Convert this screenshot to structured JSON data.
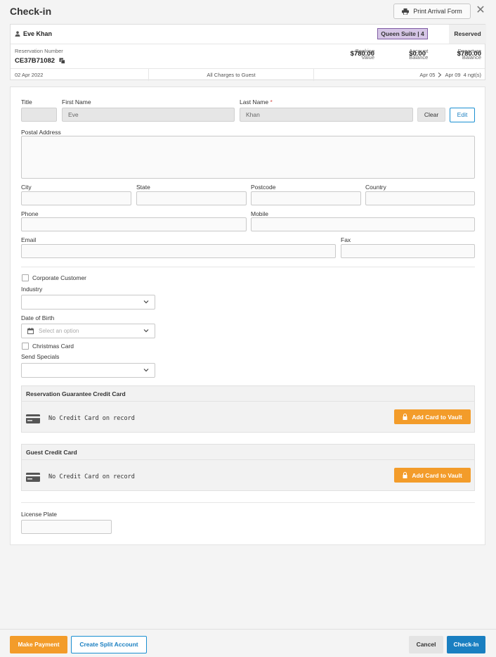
{
  "header": {
    "title": "Check-in",
    "print_label": "Print Arrival Form",
    "close_glyph": "✕"
  },
  "summary": {
    "guest_name": "Eve Khan",
    "room": "Queen Suite | 4",
    "status": "Reserved",
    "reservation_number_label": "Reservation Number",
    "reservation_number": "CE37B71082",
    "booking_value_label": "Booking Value",
    "booking_value": "$780.00",
    "account_balance_label": "Account Balance",
    "account_balance": "$0.00",
    "departure_balance_label": "Departure Balance",
    "departure_balance": "$780.00",
    "booked_date": "02 Apr 2022",
    "charges": "All Charges to Guest",
    "arrival": "Apr 05",
    "departure": "Apr 09",
    "nights": "4 ngt(s)",
    "room_color": "#d6c6e6"
  },
  "form": {
    "title_label": "Title",
    "title_value": "",
    "first_name_label": "First Name",
    "first_name": "Eve",
    "last_name_label": "Last Name",
    "required_mark": "*",
    "last_name": "Khan",
    "clear_label": "Clear",
    "edit_label": "Edit",
    "postal_address_label": "Postal Address",
    "city_label": "City",
    "state_label": "State",
    "postcode_label": "Postcode",
    "country_label": "Country",
    "phone_label": "Phone",
    "mobile_label": "Mobile",
    "email_label": "Email",
    "fax_label": "Fax",
    "corporate_label": "Corporate Customer",
    "industry_label": "Industry",
    "dob_label": "Date of Birth",
    "dob_placeholder": "Select an option",
    "christmas_label": "Christmas Card",
    "send_specials_label": "Send Specials",
    "license_plate_label": "License Plate"
  },
  "cards": [
    {
      "heading": "Reservation Guarantee Credit Card",
      "text": "No Credit Card on record",
      "button": "Add Card to Vault"
    },
    {
      "heading": "Guest Credit Card",
      "text": "No Credit Card on record",
      "button": "Add Card to Vault"
    }
  ],
  "footer": {
    "make_payment": "Make Payment",
    "split_account": "Create Split Account",
    "cancel": "Cancel",
    "check_in": "Check-In"
  },
  "colors": {
    "accent_orange": "#f39c2a",
    "accent_blue": "#1a7fc1"
  }
}
